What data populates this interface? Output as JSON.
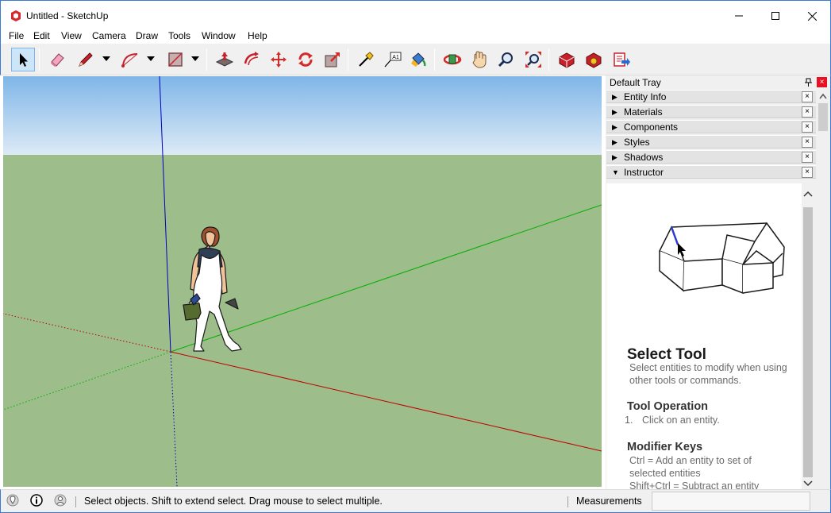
{
  "window": {
    "title": "Untitled - SketchUp",
    "buttons": [
      "minimize",
      "maximize",
      "close"
    ]
  },
  "menu": [
    "File",
    "Edit",
    "View",
    "Camera",
    "Draw",
    "Tools",
    "Window",
    "Help"
  ],
  "toolbar": {
    "tools": [
      {
        "name": "select-icon",
        "active": true
      },
      {
        "name": "eraser-icon"
      },
      {
        "name": "pencil-icon",
        "dropdown": true
      },
      {
        "name": "arc-icon",
        "dropdown": true
      },
      {
        "name": "rectangle-icon",
        "dropdown": true
      },
      {
        "name": "push-pull-icon"
      },
      {
        "name": "offset-icon"
      },
      {
        "name": "move-icon"
      },
      {
        "name": "rotate-icon"
      },
      {
        "name": "scale-icon"
      },
      {
        "name": "tape-measure-icon"
      },
      {
        "name": "text-icon"
      },
      {
        "name": "paint-bucket-icon"
      },
      {
        "name": "orbit-icon"
      },
      {
        "name": "pan-icon"
      },
      {
        "name": "zoom-icon"
      },
      {
        "name": "zoom-extents-icon"
      },
      {
        "name": "3d-warehouse-icon"
      },
      {
        "name": "extension-warehouse-icon"
      },
      {
        "name": "send-to-layout-icon"
      }
    ],
    "text_icon_label": "A1"
  },
  "tray": {
    "title": "Default Tray",
    "panels": [
      {
        "label": "Entity Info",
        "expanded": false
      },
      {
        "label": "Materials",
        "expanded": false
      },
      {
        "label": "Components",
        "expanded": false
      },
      {
        "label": "Styles",
        "expanded": false
      },
      {
        "label": "Shadows",
        "expanded": false
      },
      {
        "label": "Instructor",
        "expanded": true
      }
    ],
    "close_glyph": "×"
  },
  "instructor": {
    "title": "Select Tool",
    "description": "Select entities to modify when using other tools or commands.",
    "operation_heading": "Tool Operation",
    "operation_number": "1.",
    "operation_step": "Click on an entity.",
    "modifier_heading": "Modifier Keys",
    "modifier_line1": "Ctrl = Add an entity to set of selected entities",
    "modifier_line2": "Shift+Ctrl = Subtract an entity"
  },
  "status": {
    "text": "Select objects. Shift to extend select. Drag mouse to select multiple.",
    "measurements_label": "Measurements",
    "measurements_value": ""
  },
  "colors": {
    "sky_top": "#7fb6e8",
    "sky_bottom": "#ddeaf6",
    "ground": "#9dbd8b",
    "red_axis": "#c00000",
    "green_axis": "#00b000",
    "blue_axis": "#0000c0"
  }
}
